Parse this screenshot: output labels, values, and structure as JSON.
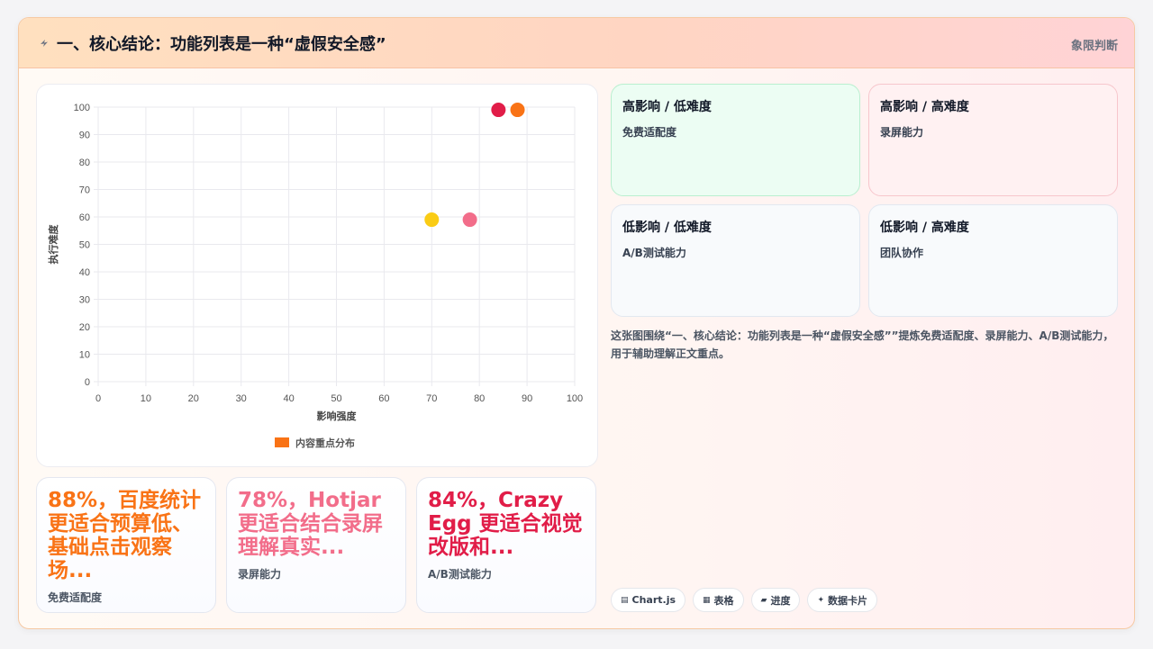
{
  "header": {
    "icon": "lightning-icon",
    "title": "一、核心结论：功能列表是一种“虚假安全感”",
    "right_label": "象限判断"
  },
  "chart_data": {
    "type": "scatter",
    "xlabel": "影响强度",
    "ylabel": "执行难度",
    "xlim": [
      0,
      100
    ],
    "ylim": [
      0,
      100
    ],
    "xticks": [
      "0",
      "10",
      "20",
      "30",
      "40",
      "50",
      "60",
      "70",
      "80",
      "90",
      "100"
    ],
    "yticks": [
      "0",
      "10",
      "20",
      "30",
      "40",
      "50",
      "60",
      "70",
      "80",
      "90",
      "100"
    ],
    "grid": true,
    "legend": {
      "position": "bottom",
      "label": "内容重点分布",
      "color": "#f97316"
    },
    "points": [
      {
        "x": 84,
        "y": 99,
        "color": "#e11d48"
      },
      {
        "x": 88,
        "y": 99,
        "color": "#f97316"
      },
      {
        "x": 70,
        "y": 59,
        "color": "#facc15"
      },
      {
        "x": 78,
        "y": 59,
        "color": "#f26d8a"
      }
    ]
  },
  "stats": [
    {
      "value": "88%，百度统计更适合预算低、基础点击观察场...",
      "label": "免费适配度",
      "color": "#f97316"
    },
    {
      "value": "78%，Hotjar 更适合结合录屏理解真实...",
      "label": "录屏能力",
      "color": "#f26d8a"
    },
    {
      "value": "84%，Crazy Egg 更适合视觉改版和...",
      "label": "A/B测试能力",
      "color": "#e11d48"
    }
  ],
  "quadrants": [
    {
      "title": "高影响 / 低难度",
      "text": "免费适配度",
      "bg": "#ecfdf3",
      "border": "#b9efcf"
    },
    {
      "title": "高影响 / 高难度",
      "text": "录屏能力",
      "bg": "#fff1f2",
      "border": "#f7c6cc"
    },
    {
      "title": "低影响 / 低难度",
      "text": "A/B测试能力",
      "bg": "#f8fafc",
      "border": "#e2e8f0"
    },
    {
      "title": "低影响 / 高难度",
      "text": "团队协作",
      "bg": "#f8fafc",
      "border": "#e2e8f0"
    }
  ],
  "note": "这张图围绕“一、核心结论：功能列表是一种“虚假安全感””提炼免费适配度、录屏能力、A/B测试能力，用于辅助理解正文重点。",
  "tags": [
    {
      "icon": "chart-icon",
      "glyph": "▤",
      "label": "Chart.js"
    },
    {
      "icon": "table-icon",
      "glyph": "▦",
      "label": "表格"
    },
    {
      "icon": "progress-icon",
      "glyph": "▰",
      "label": "进度"
    },
    {
      "icon": "sparkle-icon",
      "glyph": "✦",
      "label": "数据卡片"
    }
  ]
}
